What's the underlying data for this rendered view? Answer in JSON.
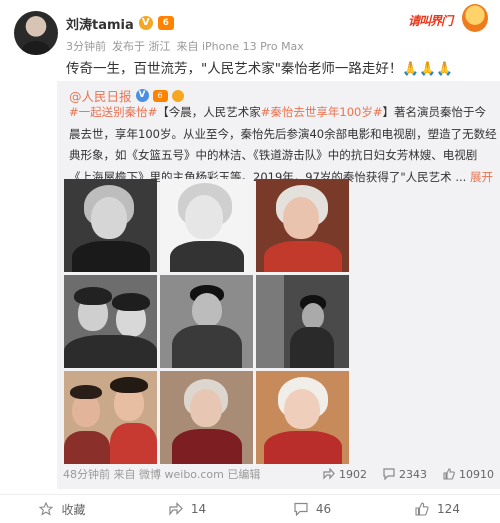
{
  "author": {
    "name": "刘涛tamia",
    "verified_icon": "verified-badge-icon",
    "vip_icon": "vip-level-icon"
  },
  "meta": {
    "time": "3分钟前",
    "location": "发布于 浙江",
    "device": "来自 iPhone 13 Pro Max"
  },
  "brand_badge": "请叫界门",
  "post_text": "传奇一生，百世流芳，\"人民艺术家\"秦怡老师一路走好！🙏🙏🙏",
  "repost": {
    "author": "@人民日报",
    "tag1": "#一起送别秦怡#",
    "bracket_open": "【今晨，人民艺术家",
    "tag2": "#秦怡去世享年100岁#",
    "bracket_close": "】",
    "body": "著名演员秦怡于今晨去世，享年100岁。从业至今，秦怡先后参演40余部电影和电视剧，塑造了无数经典形象，如《女篮五号》中的林洁、《铁道游击队》中的抗日妇女芳林嫂、电视剧《上海屋檐下》里的主角杨彩玉等。2019年，97岁的秦怡获得了\"人民艺术 ...",
    "more": "展开全文",
    "more_icon": "chevron-down-icon",
    "footer": {
      "time": "48分钟前",
      "source": "来自 微博 weibo.com",
      "edited": "已编辑",
      "shares": "1902",
      "comments": "2343",
      "likes": "10910"
    }
  },
  "actions": {
    "favorite": "收藏",
    "repost": "14",
    "comment": "46",
    "like": "124"
  },
  "colors": {
    "accent": "#eb7350",
    "muted": "#999999",
    "card_bg": "#f2f2f5"
  }
}
